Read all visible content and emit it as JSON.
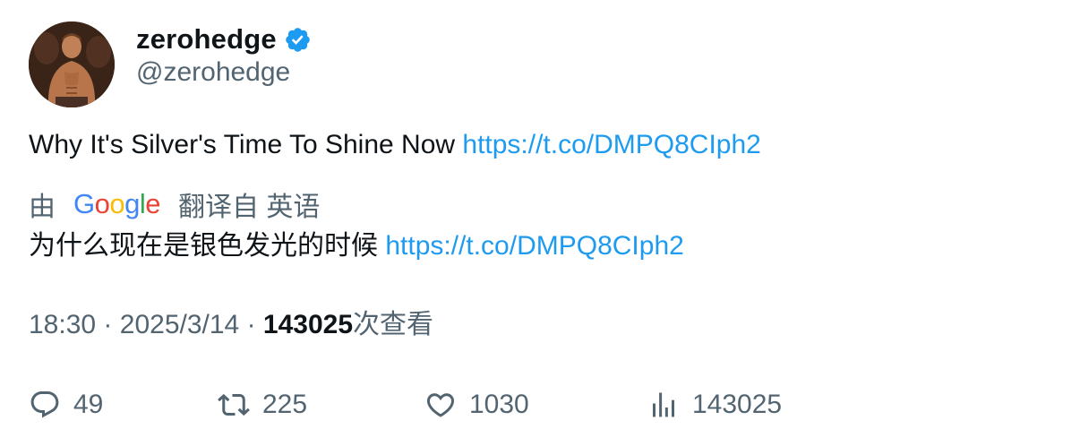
{
  "author": {
    "display_name": "zerohedge",
    "handle": "@zerohedge",
    "verified": true,
    "verified_icon": "verified-badge-icon",
    "verified_color": "#1d9bf0"
  },
  "tweet": {
    "text": "Why It's Silver's Time To Shine Now",
    "link": "https://t.co/DMPQ8CIph2"
  },
  "translation": {
    "prefix": "由",
    "provider": "Google",
    "suffix": "翻译自 英语",
    "text": "为什么现在是银色发光的时候",
    "link": "https://t.co/DMPQ8CIph2"
  },
  "meta": {
    "time": "18:30",
    "separator": "·",
    "date": "2025/3/14",
    "views_count": "143025",
    "views_label": "次查看"
  },
  "actions": {
    "reply": {
      "icon": "reply-icon",
      "count": "49"
    },
    "retweet": {
      "icon": "retweet-icon",
      "count": "225"
    },
    "like": {
      "icon": "heart-icon",
      "count": "1030"
    },
    "views": {
      "icon": "analytics-icon",
      "count": "143025"
    }
  },
  "colors": {
    "link": "#1d9bf0",
    "secondary_text": "#536471",
    "primary_text": "#0f1419"
  }
}
